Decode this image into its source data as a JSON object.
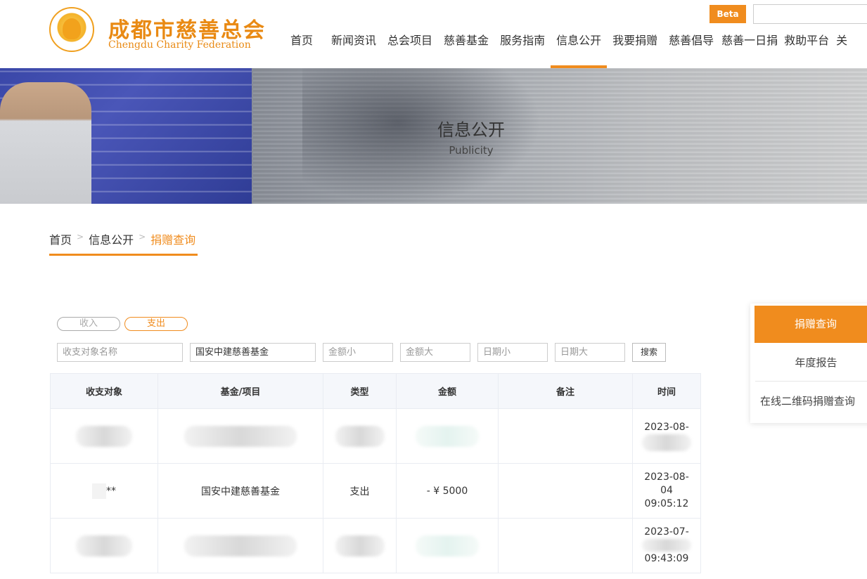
{
  "header": {
    "logo": {
      "name_cn": "成都市慈善总会",
      "name_en": "Chengdu Charity Federation"
    },
    "nav": [
      {
        "label": "首页"
      },
      {
        "label": "新闻资讯"
      },
      {
        "label": "总会项目"
      },
      {
        "label": "慈善基金"
      },
      {
        "label": "服务指南"
      },
      {
        "label": "信息公开",
        "active": true
      },
      {
        "label": "我要捐赠"
      },
      {
        "label": "慈善倡导"
      },
      {
        "label": "慈善一日捐"
      },
      {
        "label": "救助平台"
      },
      {
        "label": "关"
      }
    ],
    "beta_label": "Beta",
    "search_placeholder": ""
  },
  "banner": {
    "title": "信息公开",
    "subtitle": "Publicity"
  },
  "breadcrumb": {
    "items": [
      "首页",
      "信息公开",
      "捐赠查询"
    ],
    "separator": ">"
  },
  "toggle": {
    "income_label": "收入",
    "expense_label": "支出",
    "selected": "支出"
  },
  "filters": {
    "target_name": {
      "placeholder": "收支对象名称",
      "value": ""
    },
    "fund": {
      "placeholder": "",
      "value": "国安中建慈善基金"
    },
    "amount_min": {
      "placeholder": "金额小",
      "value": ""
    },
    "amount_max": {
      "placeholder": "金额大",
      "value": ""
    },
    "date_min": {
      "placeholder": "日期小",
      "value": ""
    },
    "date_max": {
      "placeholder": "日期大",
      "value": ""
    },
    "search_button": "搜索"
  },
  "table": {
    "headers": [
      "收支对象",
      "基金/项目",
      "类型",
      "金额",
      "备注",
      "时间"
    ],
    "rows": [
      {
        "target": "",
        "fund": "",
        "type": "",
        "amount": "",
        "note": "",
        "time_line1": "2023-08-",
        "time_line2": "",
        "time_line3": "",
        "blurred": true
      },
      {
        "target": "**",
        "fund": "国安中建慈善基金",
        "type": "支出",
        "amount": "- ¥ 5000",
        "note": "",
        "time_line1": "2023-08-",
        "time_line2": "04",
        "time_line3": "09:05:12",
        "blurred": false
      },
      {
        "target": "",
        "fund": "",
        "type": "",
        "amount": "",
        "note": "",
        "time_line1": "2023-07-",
        "time_line2": "",
        "time_line3": "09:43:09",
        "blurred": true
      }
    ]
  },
  "sidebar": {
    "items": [
      {
        "label": "捐赠查询",
        "active": true
      },
      {
        "label": "年度报告"
      },
      {
        "label": "在线二维码捐赠查询"
      }
    ]
  },
  "colors": {
    "accent": "#f08c1e",
    "amount": "#3bbfa6",
    "table_header_bg": "#f5f7fb"
  }
}
